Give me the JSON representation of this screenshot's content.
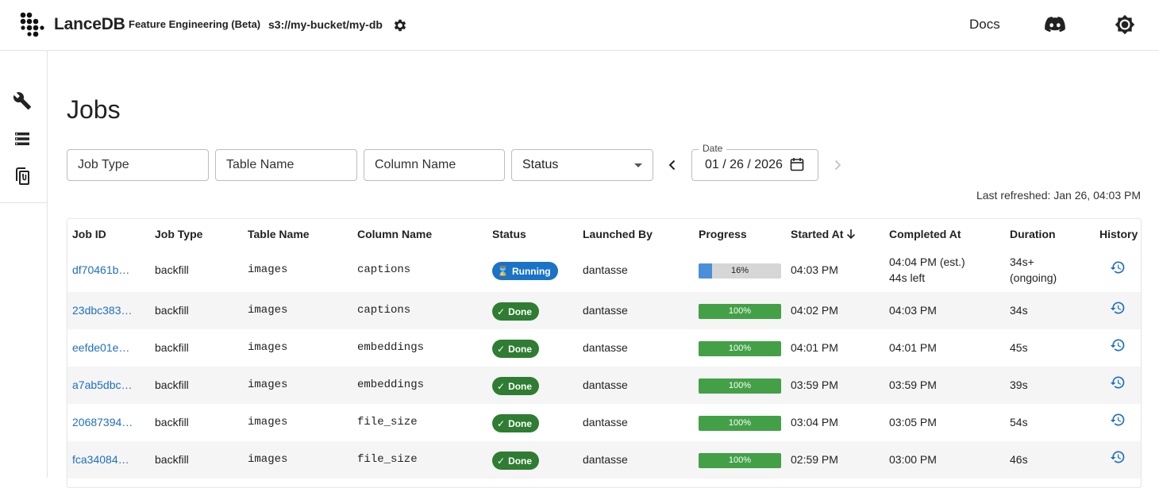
{
  "header": {
    "brand": "LanceDB",
    "subtitle": "Feature Engineering (Beta)",
    "db_path": "s3://my-bucket/my-db",
    "docs_label": "Docs"
  },
  "sidebar": {
    "items": [
      {
        "name": "wrench-icon"
      },
      {
        "name": "list-icon"
      },
      {
        "name": "clipboard-icon"
      }
    ]
  },
  "page": {
    "title": "Jobs"
  },
  "filters": {
    "job_type_placeholder": "Job Type",
    "table_name_placeholder": "Table Name",
    "column_name_placeholder": "Column Name",
    "status_label": "Status",
    "date_label": "Date",
    "date_value": "01 / 26 / 2026"
  },
  "last_refreshed": "Last refreshed: Jan 26, 04:03 PM",
  "table": {
    "columns": [
      "Job ID",
      "Job Type",
      "Table Name",
      "Column Name",
      "Status",
      "Launched By",
      "Progress",
      "Started At",
      "Completed At",
      "Duration",
      "History"
    ],
    "rows": [
      {
        "job_id": "df70461b…",
        "job_type": "backfill",
        "table_name": "images",
        "column_name": "captions",
        "status": "Running",
        "launched_by": "dantasse",
        "progress": 16,
        "progress_label": "16%",
        "started_at": "04:03 PM",
        "completed_at": "04:04 PM (est.)",
        "completed_sub": "44s left",
        "duration": "34s+",
        "duration_sub": "(ongoing)"
      },
      {
        "job_id": "23dbc383…",
        "job_type": "backfill",
        "table_name": "images",
        "column_name": "captions",
        "status": "Done",
        "launched_by": "dantasse",
        "progress": 100,
        "progress_label": "100%",
        "started_at": "04:02 PM",
        "completed_at": "04:03 PM",
        "completed_sub": "",
        "duration": "34s",
        "duration_sub": ""
      },
      {
        "job_id": "eefde01e…",
        "job_type": "backfill",
        "table_name": "images",
        "column_name": "embeddings",
        "status": "Done",
        "launched_by": "dantasse",
        "progress": 100,
        "progress_label": "100%",
        "started_at": "04:01 PM",
        "completed_at": "04:01 PM",
        "completed_sub": "",
        "duration": "45s",
        "duration_sub": ""
      },
      {
        "job_id": "a7ab5dbc…",
        "job_type": "backfill",
        "table_name": "images",
        "column_name": "embeddings",
        "status": "Done",
        "launched_by": "dantasse",
        "progress": 100,
        "progress_label": "100%",
        "started_at": "03:59 PM",
        "completed_at": "03:59 PM",
        "completed_sub": "",
        "duration": "39s",
        "duration_sub": ""
      },
      {
        "job_id": "20687394…",
        "job_type": "backfill",
        "table_name": "images",
        "column_name": "file_size",
        "status": "Done",
        "launched_by": "dantasse",
        "progress": 100,
        "progress_label": "100%",
        "started_at": "03:04 PM",
        "completed_at": "03:05 PM",
        "completed_sub": "",
        "duration": "54s",
        "duration_sub": ""
      },
      {
        "job_id": "fca34084…",
        "job_type": "backfill",
        "table_name": "images",
        "column_name": "file_size",
        "status": "Done",
        "launched_by": "dantasse",
        "progress": 100,
        "progress_label": "100%",
        "started_at": "02:59 PM",
        "completed_at": "03:00 PM",
        "completed_sub": "",
        "duration": "46s",
        "duration_sub": ""
      }
    ]
  },
  "colors": {
    "link": "#1f6fc0",
    "running": "#1a73c6",
    "done": "#2e7d32",
    "progress_running": "#4a90d9",
    "progress_done": "#43a047"
  }
}
